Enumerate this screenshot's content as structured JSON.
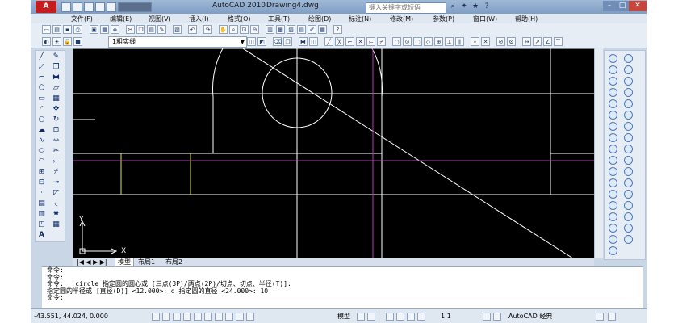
{
  "window": {
    "app_title": "AutoCAD 2010",
    "doc_title": "Drawing4.dwg",
    "help_search_placeholder": "键入关键字或短语",
    "app_logo": "A"
  },
  "menus": [
    "文件(F)",
    "编辑(E)",
    "视图(V)",
    "插入(I)",
    "格式(O)",
    "工具(T)",
    "绘图(D)",
    "标注(N)",
    "修改(M)",
    "参数(P)",
    "窗口(W)",
    "帮助(H)"
  ],
  "layer_dropdown": {
    "value": "1粗实线"
  },
  "tabs": [
    "模型",
    "布局1",
    "布局2"
  ],
  "ucs": {
    "x_label": "X",
    "y_label": "Y"
  },
  "command_lines": [
    "命令:",
    "命令:",
    "命令:  _circle 指定圆的圆心或 [三点(3P)/两点(2P)/切点、切点、半径(T)]:",
    "指定圆的半径或 [直径(D)] <12.000>: d 指定圆的直径 <24.000>: 10",
    "命令:"
  ],
  "status": {
    "coordinates": "-43.551, 44.024, 0.000",
    "model_label": "模型",
    "annotation_scale": "1:1",
    "workspace": "AutoCAD 经典"
  },
  "colors": {
    "canvas_bg": "#000000",
    "geometry": "#ffffff",
    "yellow_line": "#e5e536",
    "magenta_line": "#b23cb2",
    "title_bg": "#8faacd"
  }
}
